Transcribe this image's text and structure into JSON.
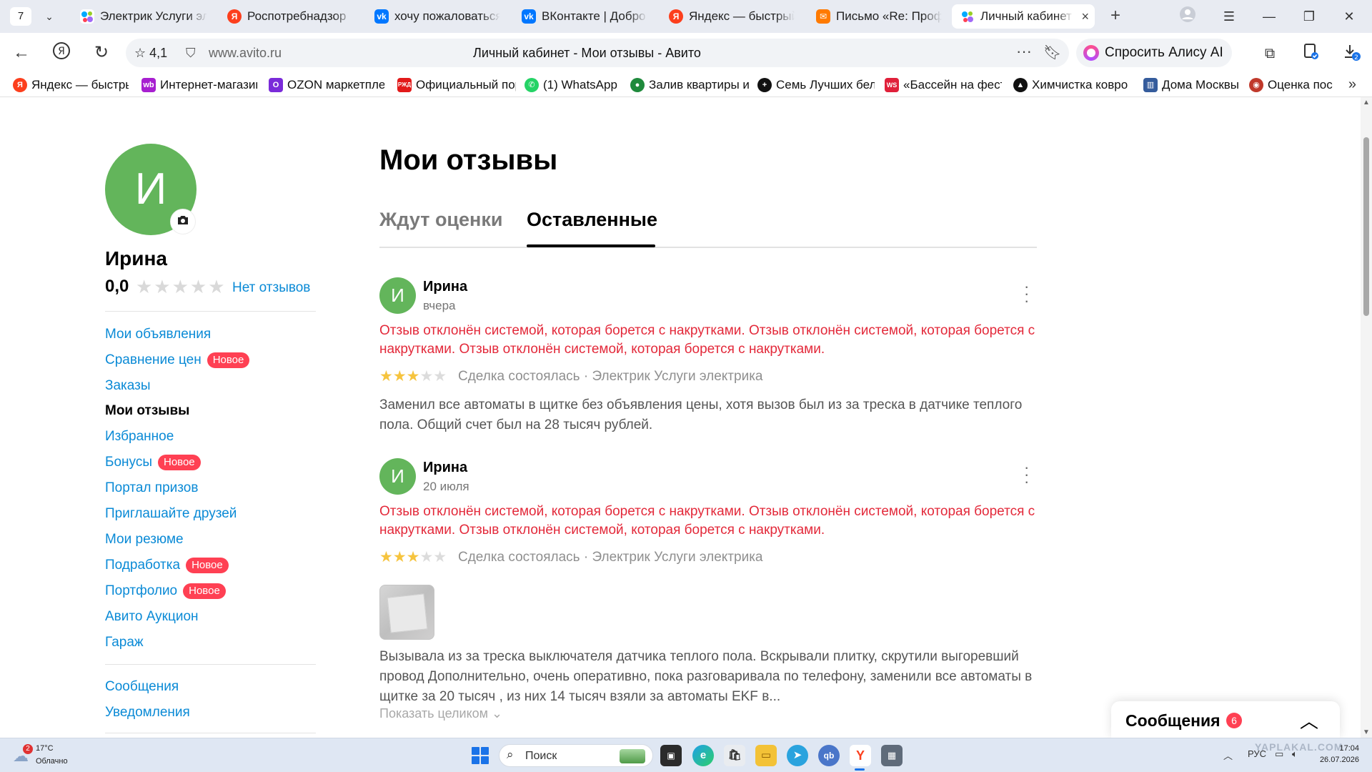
{
  "browser": {
    "tab_count": "7",
    "tabs": [
      {
        "title": "Электрик Услуги электрика",
        "favicon": "avito-icon",
        "color": "#ffffff"
      },
      {
        "title": "Роспотребнадзор",
        "favicon": "yandex-icon",
        "color": "#fc3f1d"
      },
      {
        "title": "хочу пожаловаться",
        "favicon": "vk-icon",
        "color": "#0077ff"
      },
      {
        "title": "ВКонтакте | Добро пожаловать",
        "favicon": "vk-icon",
        "color": "#0077ff"
      },
      {
        "title": "Яндекс — быстрый поиск",
        "favicon": "yandex-icon",
        "color": "#fc3f1d"
      },
      {
        "title": "Письмо «Re: Профи»",
        "favicon": "mail-icon",
        "color": "#ff7a00"
      },
      {
        "title": "Личный кабинет",
        "favicon": "avito-icon",
        "color": "#ffffff",
        "active": true
      }
    ],
    "address": {
      "rating": "4,1",
      "url": "www.avito.ru",
      "page_title": "Личный кабинет - Мои отзывы - Авито"
    },
    "alice_label": "Спросить Алису AI",
    "downloads_badge": "2",
    "bookmarks": [
      {
        "label": "Яндекс — быстрый поиск",
        "icon": "yandex-icon",
        "color": "#fc3f1d",
        "glyph": "Я"
      },
      {
        "label": "Интернет-магазин Wildberries",
        "icon": "wildberries-icon",
        "color": "#a71fd0",
        "glyph": "wb"
      },
      {
        "label": "OZON маркетплейс",
        "icon": "ozon-icon",
        "color": "#7a2bd9",
        "glyph": "O"
      },
      {
        "label": "Официальный портал",
        "icon": "rzd-icon",
        "color": "#e21a1a",
        "glyph": "РЖД"
      },
      {
        "label": "(1) WhatsApp",
        "icon": "whatsapp-icon",
        "color": "#25d366",
        "glyph": "✆"
      },
      {
        "label": "Залив квартиры и",
        "icon": "geo-pin-icon",
        "color": "#1f8a3c",
        "glyph": "●"
      },
      {
        "label": "Семь Лучших бел",
        "icon": "plus-icon",
        "color": "#111111",
        "glyph": "+"
      },
      {
        "label": "«Бассейн на фест",
        "icon": "pool-icon",
        "color": "#e0203a",
        "glyph": "WS"
      },
      {
        "label": "Химчистка ковро",
        "icon": "triangle-icon",
        "color": "#111111",
        "glyph": "▲"
      },
      {
        "label": "Дома Москвы",
        "icon": "buildings-icon",
        "color": "#355c9c",
        "glyph": "▥"
      },
      {
        "label": "Оценка пос",
        "icon": "pin-icon",
        "color": "#c0392b",
        "glyph": "◉"
      }
    ]
  },
  "profile": {
    "avatar_letter": "И",
    "name": "Ирина",
    "rating": "0,0",
    "stars": "★★★★★",
    "no_reviews_label": "Нет отзывов"
  },
  "sidebar": {
    "items": [
      {
        "label": "Мои объявления"
      },
      {
        "label": "Сравнение цен",
        "badge": "Новое"
      },
      {
        "label": "Заказы"
      },
      {
        "label": "Мои отзывы",
        "current": true
      },
      {
        "label": "Избранное"
      },
      {
        "label": "Бонусы",
        "badge": "Новое"
      },
      {
        "label": "Портал призов"
      },
      {
        "label": "Приглашайте друзей"
      },
      {
        "label": "Мои резюме"
      },
      {
        "label": "Подработка",
        "badge": "Новое"
      },
      {
        "label": "Портфолио",
        "badge": "Новое"
      },
      {
        "label": "Авито Аукцион"
      },
      {
        "label": "Гараж"
      }
    ],
    "items2": [
      {
        "label": "Сообщения"
      },
      {
        "label": "Уведомления"
      }
    ]
  },
  "main": {
    "title": "Мои отзывы",
    "tabs": [
      {
        "label": "Ждут оценки"
      },
      {
        "label": "Оставленные",
        "active": true
      }
    ],
    "reviews": [
      {
        "avatar_letter": "И",
        "author": "Ирина",
        "date": "вчера",
        "rejected": "Отзыв отклонён системой, которая борется с накрутками. Отзыв отклонён системой, которая борется с накрутками. Отзыв отклонён системой, которая борется с накрутками.",
        "rating": 3,
        "meta": "Сделка состоялась · Электрик Услуги электрика",
        "text": "Заменил все автоматы в щитке без объявления цены, хотя вызов был из за треска в датчике теплого пола. Общий счет был на 28 тысяч рублей."
      },
      {
        "avatar_letter": "И",
        "author": "Ирина",
        "date": "20 июля",
        "rejected": "Отзыв отклонён системой, которая борется с накрутками. Отзыв отклонён системой, которая борется с накрутками. Отзыв отклонён системой, которая борется с накрутками.",
        "rating": 3,
        "meta": "Сделка состоялась · Электрик Услуги электрика",
        "text": "Вызывала из за треска выключателя датчика теплого пола. Вскрывали плитку, скрутили выгоревший провод Дополнительно, очень оперативно, пока разговаривала по телефону, заменили все автоматы в щитке за 20 тысяч , из них 14 тысяч взяли за автоматы EKF в...",
        "expand_label": "Показать целиком ⌄"
      }
    ]
  },
  "messages_widget": {
    "title": "Сообщения",
    "count": "6"
  },
  "taskbar": {
    "weather_temp": "17°C",
    "weather_cond": "Облачно",
    "weather_badge": "2",
    "search_placeholder": "Поиск",
    "lang": "РУС",
    "time": "17:04",
    "date": "26.07.2026",
    "watermark": "YAPLAKAL.COM"
  }
}
